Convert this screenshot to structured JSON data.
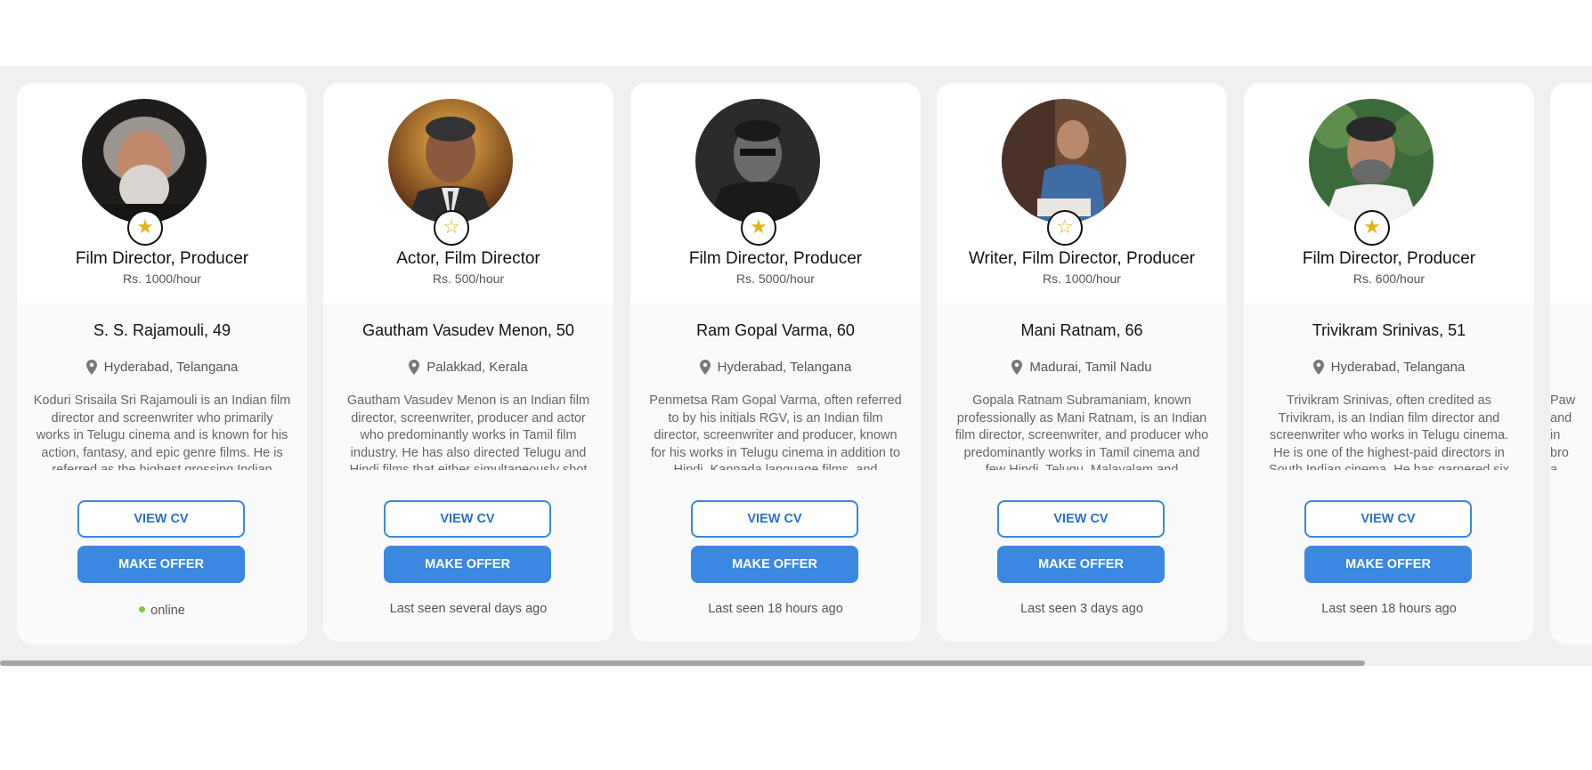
{
  "icons": {
    "star_filled": "★",
    "star_outline": "☆",
    "pin": "map-pin-icon"
  },
  "colors": {
    "accent": "#3b88e3",
    "star": "#e1b21a",
    "online": "#7ac943"
  },
  "buttons": {
    "view_cv": "VIEW CV",
    "make_offer": "MAKE OFFER"
  },
  "cards": [
    {
      "profession": "Film Director, Producer",
      "rate": "Rs. 1000/hour",
      "name": "S. S. Rajamouli, 49",
      "location": "Hyderabad, Telangana",
      "bio": "Koduri Srisaila Sri Rajamouli is an Indian film director and screenwriter who primarily works in Telugu cinema and is known for his action, fantasy, and epic genre films. He is referred as the highest grossing Indian",
      "status": "online",
      "favorite": true
    },
    {
      "profession": "Actor, Film Director",
      "rate": "Rs. 500/hour",
      "name": "Gautham Vasudev Menon, 50",
      "location": "Palakkad, Kerala",
      "bio": "Gautham Vasudev Menon is an Indian film director, screenwriter, producer and actor who predominantly works in Tamil film industry. He has also directed Telugu and Hindi films that either simultaneously shot",
      "status": "Last seen several days ago",
      "favorite": false
    },
    {
      "profession": "Film Director, Producer",
      "rate": "Rs. 5000/hour",
      "name": "Ram Gopal Varma, 60",
      "location": "Hyderabad, Telangana",
      "bio": "Penmetsa Ram Gopal Varma, often referred to by his initials RGV, is an Indian film director, screenwriter and producer, known for his works in Telugu cinema in addition to Hindi, Kannada language films, and",
      "status": "Last seen 18 hours ago",
      "favorite": true
    },
    {
      "profession": "Writer, Film Director, Producer",
      "rate": "Rs. 1000/hour",
      "name": "Mani Ratnam, 66",
      "location": "Madurai, Tamil Nadu",
      "bio": "Gopala Ratnam Subramaniam, known professionally as Mani Ratnam, is an Indian film director, screenwriter, and producer who predominantly works in Tamil cinema and few Hindi, Telugu, Malayalam and",
      "status": "Last seen 3 days ago",
      "favorite": false
    },
    {
      "profession": "Film Director, Producer",
      "rate": "Rs. 600/hour",
      "name": "Trivikram Srinivas, 51",
      "location": "Hyderabad, Telangana",
      "bio": "Trivikram Srinivas, often credited as Trivikram, is an Indian film director and screenwriter who works in Telugu cinema. He is one of the highest-paid directors in South Indian cinema. He has garnered six",
      "status": "Last seen 18 hours ago",
      "favorite": true
    },
    {
      "profession": "",
      "rate": "",
      "name": "",
      "location": "",
      "bio": "Paw and in bro a",
      "status": "",
      "favorite": false
    }
  ]
}
